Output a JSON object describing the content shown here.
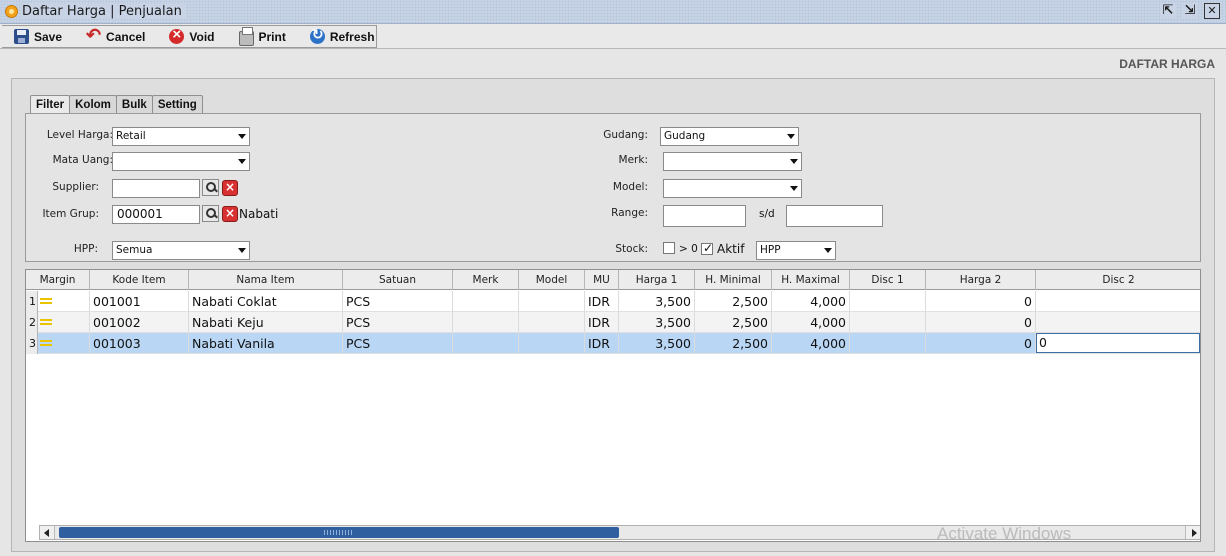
{
  "window": {
    "title": "Daftar Harga | Penjualan",
    "buttons": {
      "restore": "⇱",
      "maximize": "⇲",
      "close": "✕"
    }
  },
  "toolbar": {
    "save": "Save",
    "cancel": "Cancel",
    "void": "Void",
    "print": "Print",
    "refresh": "Refresh"
  },
  "section_label": "DAFTAR HARGA",
  "tabs": [
    {
      "label": "Filter",
      "active": true
    },
    {
      "label": "Kolom"
    },
    {
      "label": "Bulk"
    },
    {
      "label": "Setting"
    }
  ],
  "filter": {
    "level_harga": {
      "label": "Level Harga:",
      "value": "Retail"
    },
    "mata_uang": {
      "label": "Mata Uang:",
      "value": ""
    },
    "supplier": {
      "label": "Supplier:",
      "value": ""
    },
    "item_grup": {
      "label": "Item Grup:",
      "value": "000001",
      "name": "Nabati"
    },
    "hpp": {
      "label": "HPP:",
      "value": "Semua"
    },
    "gudang": {
      "label": "Gudang:",
      "value": "Gudang"
    },
    "merk": {
      "label": "Merk:",
      "value": ""
    },
    "model": {
      "label": "Model:",
      "value": ""
    },
    "range": {
      "label": "Range:",
      "from": "",
      "sep": "s/d",
      "to": ""
    },
    "stock": {
      "label": "Stock:",
      "gt_zero_label": "> 0",
      "gt_zero_checked": false,
      "aktif_label": "Aktif",
      "aktif_checked": true,
      "basis": "HPP"
    }
  },
  "grid": {
    "columns": [
      "Margin",
      "Kode Item",
      "Nama Item",
      "Satuan",
      "Merk",
      "Model",
      "MU",
      "Harga 1",
      "H. Minimal",
      "H. Maximal",
      "Disc 1",
      "Harga 2",
      "Disc 2"
    ],
    "rows": [
      {
        "no": "1",
        "kode": "001001",
        "nama": "Nabati Coklat",
        "satuan": "PCS",
        "merk": "",
        "model": "",
        "mu": "IDR",
        "harga1": "3,500",
        "hmin": "2,500",
        "hmax": "4,000",
        "disc1": "",
        "harga2": "0",
        "disc2": ""
      },
      {
        "no": "2",
        "kode": "001002",
        "nama": "Nabati Keju",
        "satuan": "PCS",
        "merk": "",
        "model": "",
        "mu": "IDR",
        "harga1": "3,500",
        "hmin": "2,500",
        "hmax": "4,000",
        "disc1": "",
        "harga2": "0",
        "disc2": ""
      },
      {
        "no": "3",
        "kode": "001003",
        "nama": "Nabati Vanila",
        "satuan": "PCS",
        "merk": "",
        "model": "",
        "mu": "IDR",
        "harga1": "3,500",
        "hmin": "2,500",
        "hmax": "4,000",
        "disc1": "",
        "harga2": "0",
        "disc2": "0"
      }
    ],
    "selected_row": 3
  },
  "watermark": "Activate Windows"
}
